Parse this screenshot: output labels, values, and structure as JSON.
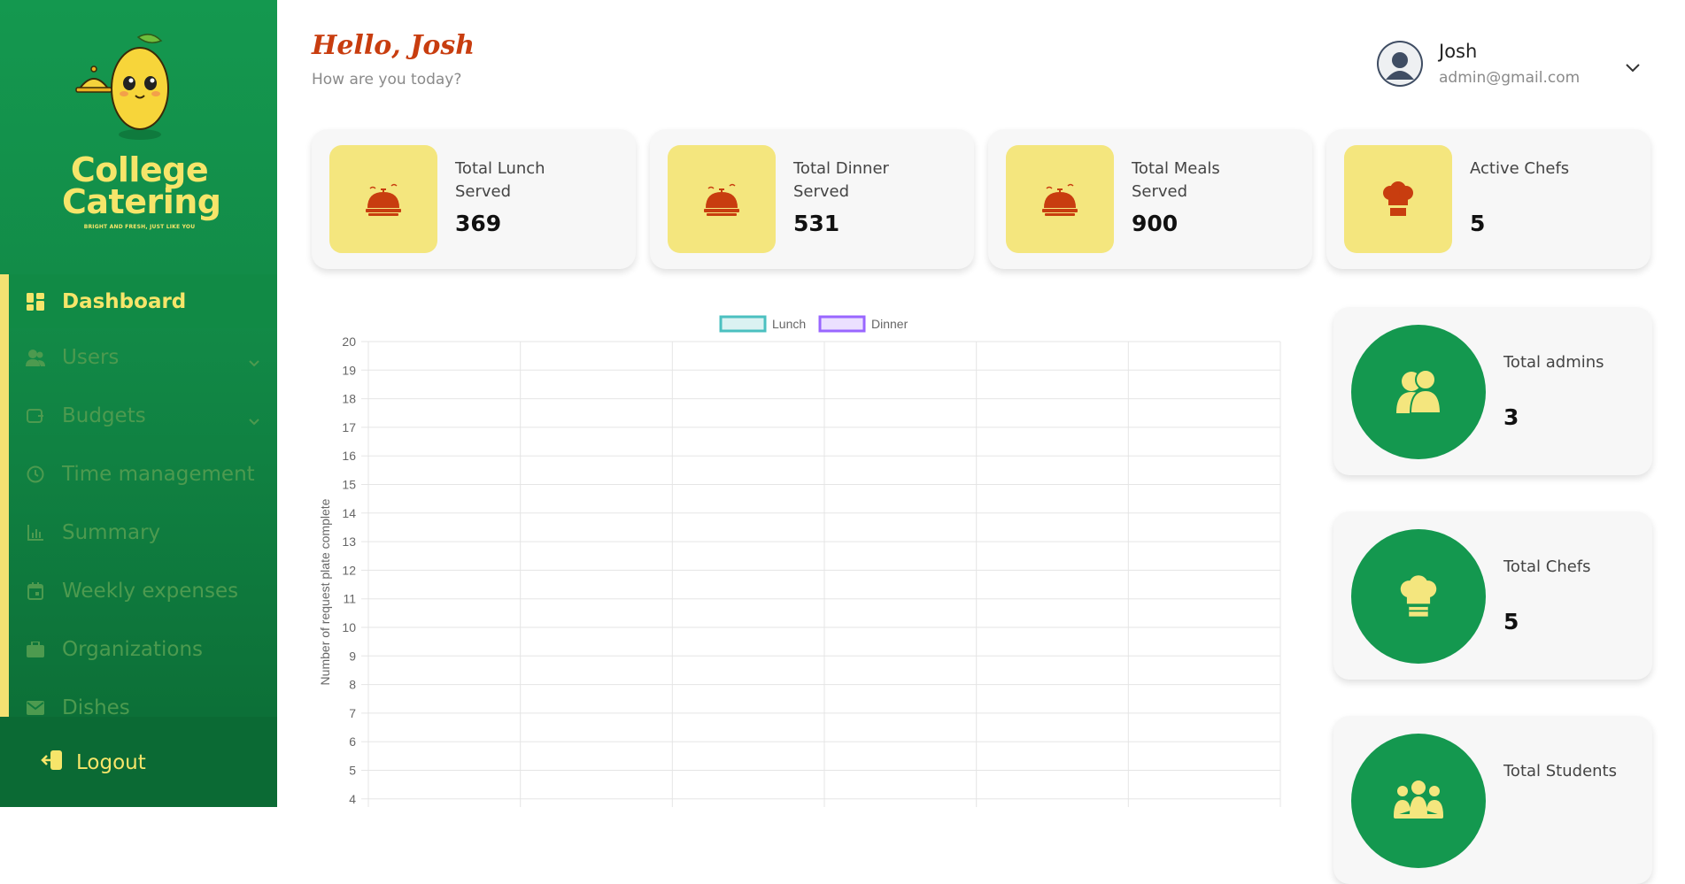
{
  "brand": {
    "name_line1": "College",
    "name_line2": "Catering",
    "tagline": "BRIGHT AND FRESH, JUST LIKE YOU"
  },
  "sidebar": {
    "items": [
      {
        "label": "Dashboard",
        "icon": "dashboard-icon",
        "active": true
      },
      {
        "label": "Users",
        "icon": "users-icon",
        "has_submenu": true
      },
      {
        "label": "Budgets",
        "icon": "wallet-icon",
        "has_submenu": true
      },
      {
        "label": "Time management",
        "icon": "clock-icon"
      },
      {
        "label": "Summary",
        "icon": "bar-chart-icon"
      },
      {
        "label": "Weekly expenses",
        "icon": "calendar-icon"
      },
      {
        "label": "Organizations",
        "icon": "briefcase-icon"
      },
      {
        "label": "Dishes",
        "icon": "envelope-icon"
      }
    ],
    "logout_label": "Logout"
  },
  "header": {
    "greeting": "Hello, Josh",
    "subtitle": "How are you today?"
  },
  "user": {
    "name": "Josh",
    "email": "admin@gmail.com"
  },
  "stats": [
    {
      "label": "Total Lunch Served",
      "value": "369",
      "icon": "cloche-icon"
    },
    {
      "label": "Total Dinner Served",
      "value": "531",
      "icon": "cloche-icon"
    },
    {
      "label": "Total Meals Served",
      "value": "900",
      "icon": "cloche-icon"
    },
    {
      "label": "Active Chefs",
      "value": "5",
      "icon": "chef-hat-icon"
    }
  ],
  "side_cards": [
    {
      "label": "Total admins",
      "value": "3",
      "icon": "admins-icon"
    },
    {
      "label": "Total Chefs",
      "value": "5",
      "icon": "chef-hat-icon"
    },
    {
      "label": "Total Students",
      "value": "",
      "icon": "students-icon"
    }
  ],
  "colors": {
    "sidebar_green": "#14984f",
    "accent_yellow": "#f4e67e",
    "greeting_red": "#c83d0f",
    "lunch_series": "#4bc0c0",
    "dinner_series": "#9966ff"
  },
  "chart_data": {
    "type": "line",
    "legend": [
      "Lunch",
      "Dinner"
    ],
    "legend_position": "top",
    "series": [
      {
        "name": "Lunch",
        "values": []
      },
      {
        "name": "Dinner",
        "values": []
      }
    ],
    "ylabel": "Number of request plate complete",
    "ylim": [
      4,
      20
    ],
    "yticks": [
      "20",
      "19",
      "18",
      "17",
      "16",
      "15",
      "14",
      "13",
      "12",
      "11",
      "10",
      "9",
      "8",
      "7",
      "6",
      "5",
      "4"
    ],
    "x_gridlines": 6,
    "grid": true
  }
}
